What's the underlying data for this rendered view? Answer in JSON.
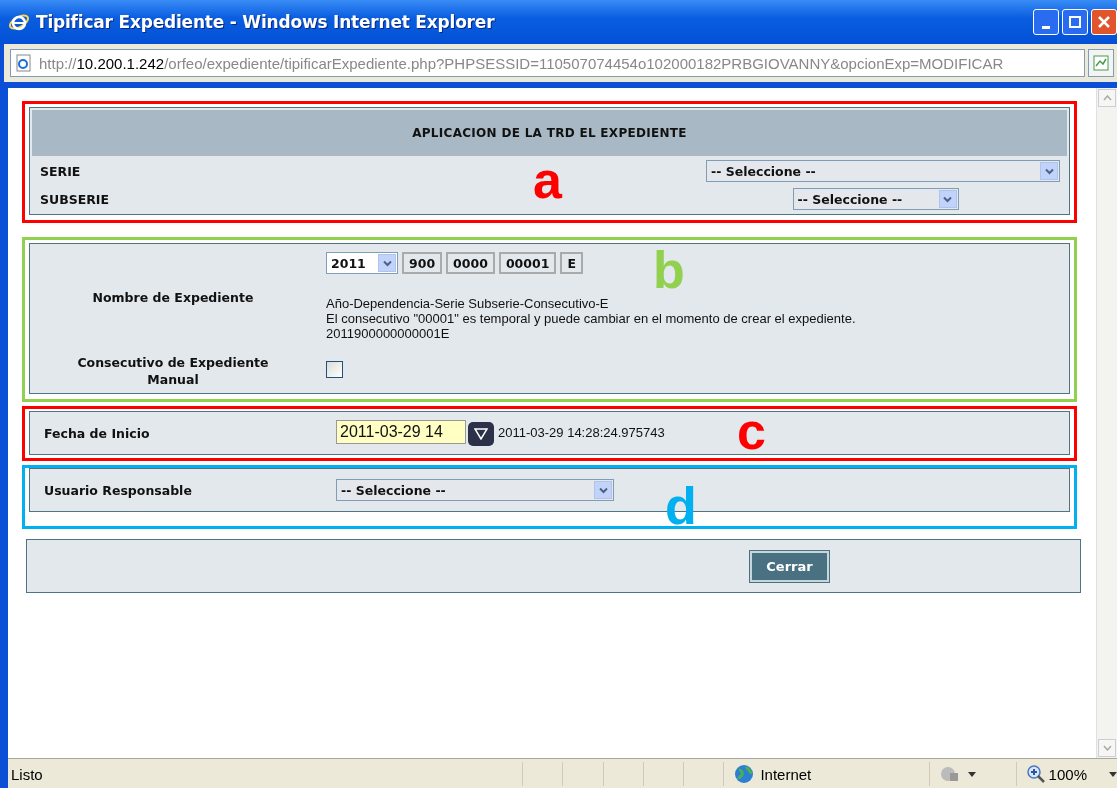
{
  "window": {
    "title": "Tipificar Expediente - Windows Internet Explorer"
  },
  "address_bar": {
    "scheme": "http://",
    "host": "10.200.1.242",
    "path": "/orfeo/expediente/tipificarExpediente.php?PHPSESSID=110507074454o102000182PRBGIOVANNY&opcionExp=MODIFICAR"
  },
  "trd": {
    "annotation": {
      "label": "a",
      "color": "#ff0000"
    },
    "heading": "APLICACION DE LA TRD EL EXPEDIENTE",
    "rows": [
      {
        "label": "SERIE",
        "select": "-- Seleccione --",
        "kind": "wide"
      },
      {
        "label": "SUBSERIE",
        "select": "-- Seleccione --",
        "kind": "compact"
      }
    ]
  },
  "expediente": {
    "annotation": {
      "label": "b",
      "color": "#92d050"
    },
    "name_label": "Nombre de Expediente",
    "year_select": "2011",
    "fields": [
      "900",
      "0000",
      "00001",
      "E"
    ],
    "format": "Año-Dependencia-Serie Subserie-Consecutivo-E",
    "note": "El consecutivo \"00001\" es temporal y puede cambiar en el momento de crear el expediente.",
    "code": "2011900000000001E",
    "manual_label": "Consecutivo de Expediente Manual",
    "manual_checked": false
  },
  "fecha": {
    "annotation": {
      "label": "c",
      "color": "#ff0000"
    },
    "label": "Fecha de Inicio",
    "value": "2011-03-29 14",
    "timestamp": "2011-03-29 14:28:24.975743"
  },
  "usuario": {
    "annotation": {
      "label": "d",
      "color": "#00b0f0"
    },
    "label": "Usuario Responsable",
    "select": "-- Seleccione --"
  },
  "footer": {
    "button": "Cerrar"
  },
  "status_bar": {
    "status": "Listo",
    "zone": "Internet",
    "zoom": "100%"
  }
}
